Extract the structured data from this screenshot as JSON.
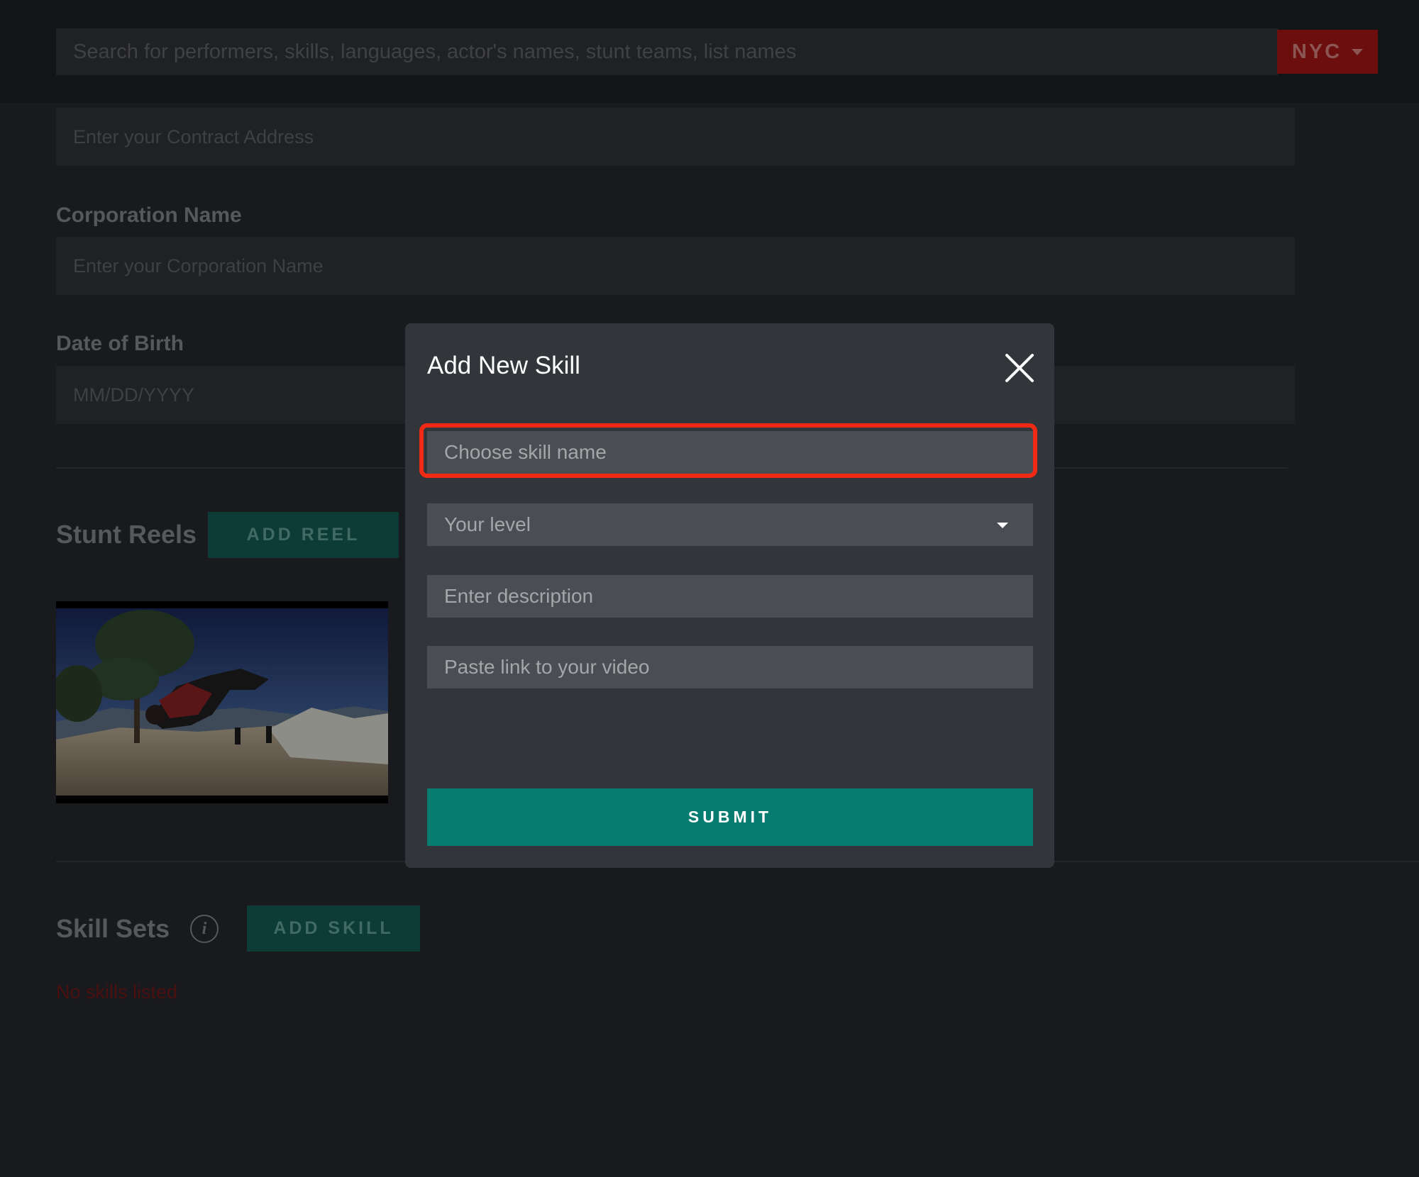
{
  "header": {
    "search_placeholder": "Search for performers, skills, languages, actor's names, stunt teams, list names",
    "city": "NYC"
  },
  "form": {
    "contract_address_placeholder": "Enter your Contract Address",
    "corporation_label": "Corporation Name",
    "corporation_placeholder": "Enter your Corporation Name",
    "dob_label": "Date of Birth",
    "dob_placeholder": "MM/DD/YYYY"
  },
  "stunt_reels": {
    "title": "Stunt Reels",
    "add_button": "ADD REEL"
  },
  "skill_sets": {
    "title": "Skill Sets",
    "info_glyph": "i",
    "add_button": "ADD SKILL",
    "empty_text": "No skills listed"
  },
  "modal": {
    "title": "Add New Skill",
    "skill_name_placeholder": "Choose skill name",
    "level_placeholder": "Your level",
    "description_placeholder": "Enter description",
    "video_link_placeholder": "Paste link to your video",
    "submit_label": "SUBMIT"
  },
  "colors": {
    "accent_green": "#067b6f",
    "city_red": "#6b0e0d",
    "highlight": "#f02a14"
  }
}
